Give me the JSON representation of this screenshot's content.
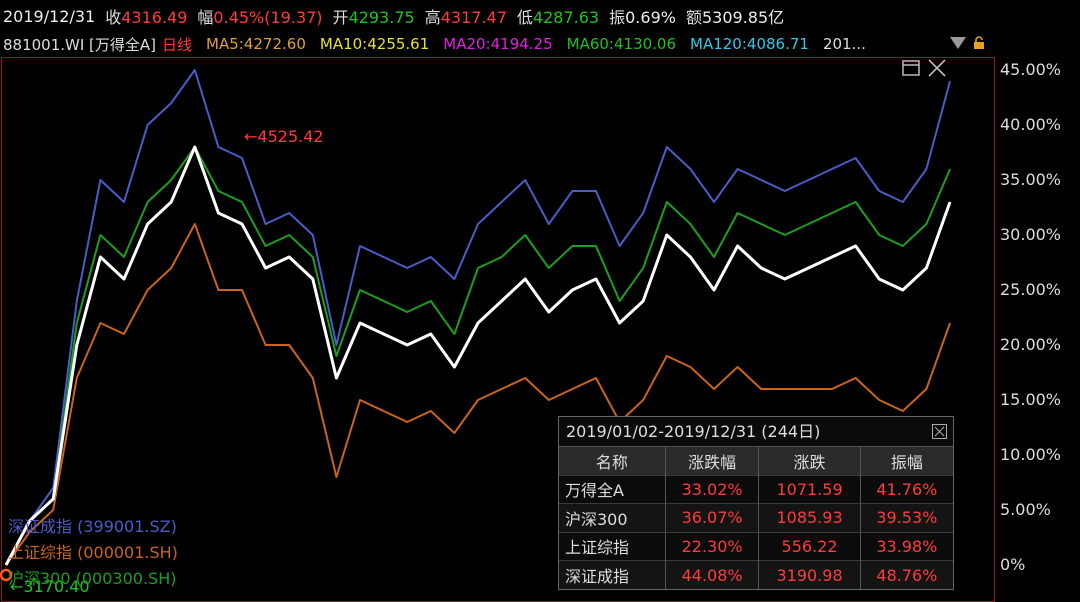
{
  "infobar": {
    "date": "2019/12/31",
    "close_label": "收",
    "close_value": "4316.49",
    "change_label": "幅",
    "change_value": "0.45%(19.37)",
    "open_label": "开",
    "open_value": "4293.75",
    "high_label": "高",
    "high_value": "4317.47",
    "low_label": "低",
    "low_value": "4287.63",
    "amp_label": "振",
    "amp_value": "0.69%",
    "amount_label": "额",
    "amount_value": "5309.85亿"
  },
  "mabar": {
    "code": "881001.WI [万得全A]",
    "period": "日线",
    "ma5": "MA5:4272.60",
    "ma10": "MA10:4255.61",
    "ma20": "MA20:4194.25",
    "ma60": "MA60:4130.06",
    "ma120": "MA120:4086.71",
    "more": "201..."
  },
  "colors": {
    "wind_a": "#ffffff",
    "csi300": "#1e9e1e",
    "sse": "#c8641e",
    "szse": "#4a5cc8",
    "up": "#ff3b3b",
    "down": "#22c322",
    "ma5": "#e0a030",
    "ma10": "#e8e030",
    "ma20": "#e020e0",
    "ma60": "#20c020",
    "ma120": "#30c8e8"
  },
  "annotations": {
    "peak": "←4525.42",
    "low": "←3170.40"
  },
  "legend": [
    {
      "name": "深证成指 (399001.SZ)"
    },
    {
      "name": "上证综指 (000001.SH)"
    },
    {
      "name": "沪深300 (000300.SH)"
    }
  ],
  "chart_data": {
    "type": "line",
    "y_ticks": [
      "45.00%",
      "40.00%",
      "35.00%",
      "30.00%",
      "25.00%",
      "20.00%",
      "15.00%",
      "10.00%",
      "5.00%",
      "0%"
    ],
    "ylim": [
      0,
      45
    ],
    "x_range": [
      "2019/01/02",
      "2019/12/31"
    ],
    "series": [
      {
        "name": "万得全A",
        "color": "#ffffff",
        "values": [
          0,
          4,
          6,
          20,
          28,
          26,
          31,
          33,
          38,
          32,
          31,
          27,
          28,
          26,
          17,
          22,
          21,
          20,
          21,
          18,
          22,
          24,
          26,
          23,
          25,
          26,
          22,
          24,
          30,
          28,
          25,
          29,
          27,
          26,
          27,
          28,
          29,
          26,
          25,
          27,
          33
        ]
      },
      {
        "name": "沪深300",
        "color": "#1e9e1e",
        "values": [
          0,
          4,
          6,
          22,
          30,
          28,
          33,
          35,
          38,
          34,
          33,
          29,
          30,
          28,
          19,
          25,
          24,
          23,
          24,
          21,
          27,
          28,
          30,
          27,
          29,
          29,
          24,
          27,
          33,
          31,
          28,
          32,
          31,
          30,
          31,
          32,
          33,
          30,
          29,
          31,
          36
        ]
      },
      {
        "name": "上证综指",
        "color": "#c8641e",
        "values": [
          0,
          3,
          5,
          17,
          22,
          21,
          25,
          27,
          31,
          25,
          25,
          20,
          20,
          17,
          8,
          15,
          14,
          13,
          14,
          12,
          15,
          16,
          17,
          15,
          16,
          17,
          13,
          15,
          19,
          18,
          16,
          18,
          16,
          16,
          16,
          16,
          17,
          15,
          14,
          16,
          22
        ]
      },
      {
        "name": "深证成指",
        "color": "#4a5cc8",
        "values": [
          0,
          4,
          7,
          24,
          35,
          33,
          40,
          42,
          45,
          38,
          37,
          31,
          32,
          30,
          20,
          29,
          28,
          27,
          28,
          26,
          31,
          33,
          35,
          31,
          34,
          34,
          29,
          32,
          38,
          36,
          33,
          36,
          35,
          34,
          35,
          36,
          37,
          34,
          33,
          36,
          44
        ]
      }
    ]
  },
  "panel": {
    "title": "2019/01/02-2019/12/31 (244日)",
    "headers": [
      "名称",
      "涨跌幅",
      "涨跌",
      "振幅"
    ],
    "rows": [
      [
        "万得全A",
        "33.02%",
        "1071.59",
        "41.76%"
      ],
      [
        "沪深300",
        "36.07%",
        "1085.93",
        "39.53%"
      ],
      [
        "上证综指",
        "22.30%",
        "556.22",
        "33.98%"
      ],
      [
        "深证成指",
        "44.08%",
        "3190.98",
        "48.76%"
      ]
    ]
  }
}
